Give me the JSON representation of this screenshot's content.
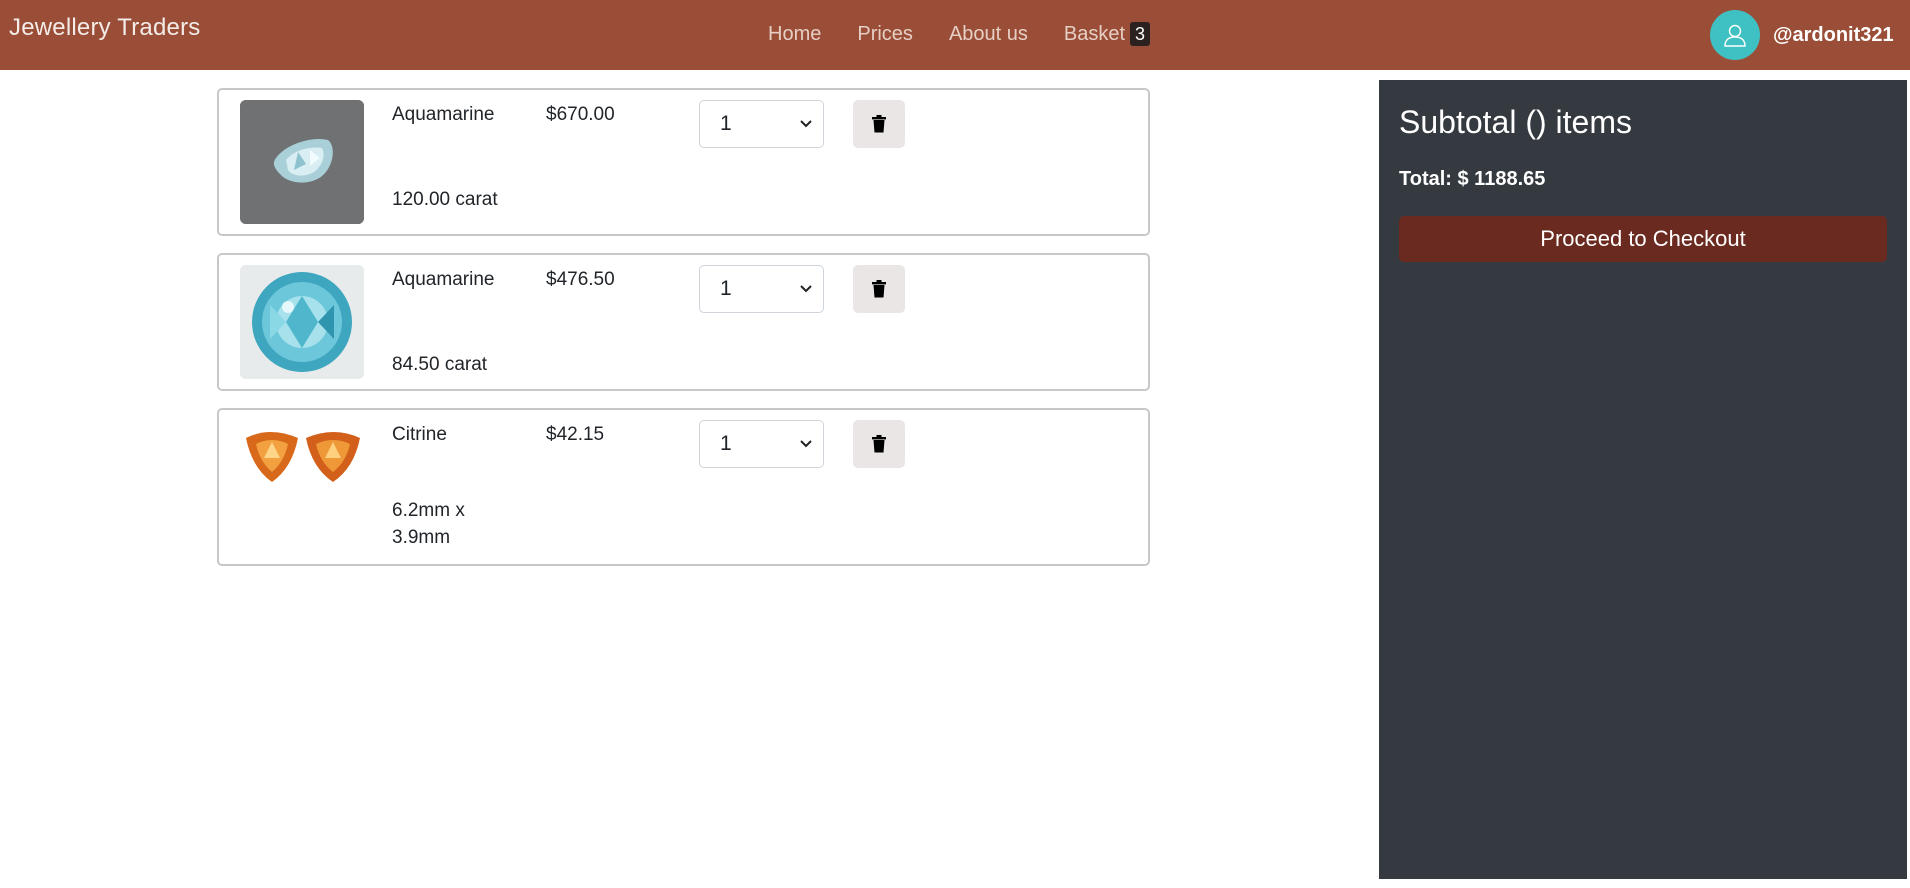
{
  "header": {
    "brand": "Jewellery Traders",
    "nav": {
      "home": "Home",
      "prices": "Prices",
      "about": "About us",
      "basket": "Basket",
      "basket_count": "3"
    },
    "username": "@ardonit321",
    "avatar_icon": "user-icon"
  },
  "cart": {
    "items": [
      {
        "name": "Aquamarine",
        "price": "$670.00",
        "size": "120.00 carat",
        "quantity": "1",
        "image": "aquamarine-pear-gem"
      },
      {
        "name": "Aquamarine",
        "price": "$476.50",
        "size": "84.50 carat",
        "quantity": "1",
        "image": "aquamarine-round-gem"
      },
      {
        "name": "Citrine",
        "price": "$42.15",
        "size": "6.2mm x 3.9mm",
        "quantity": "1",
        "image": "citrine-trillion-pair"
      }
    ]
  },
  "summary": {
    "title": "Subtotal () items",
    "total": "Total: $ 1188.65",
    "checkout_label": "Proceed to Checkout"
  },
  "colors": {
    "header_bg": "#9a4e37",
    "summary_bg": "#343a40",
    "checkout_bg": "#6b2a20",
    "avatar_bg": "#3fc1c4"
  }
}
